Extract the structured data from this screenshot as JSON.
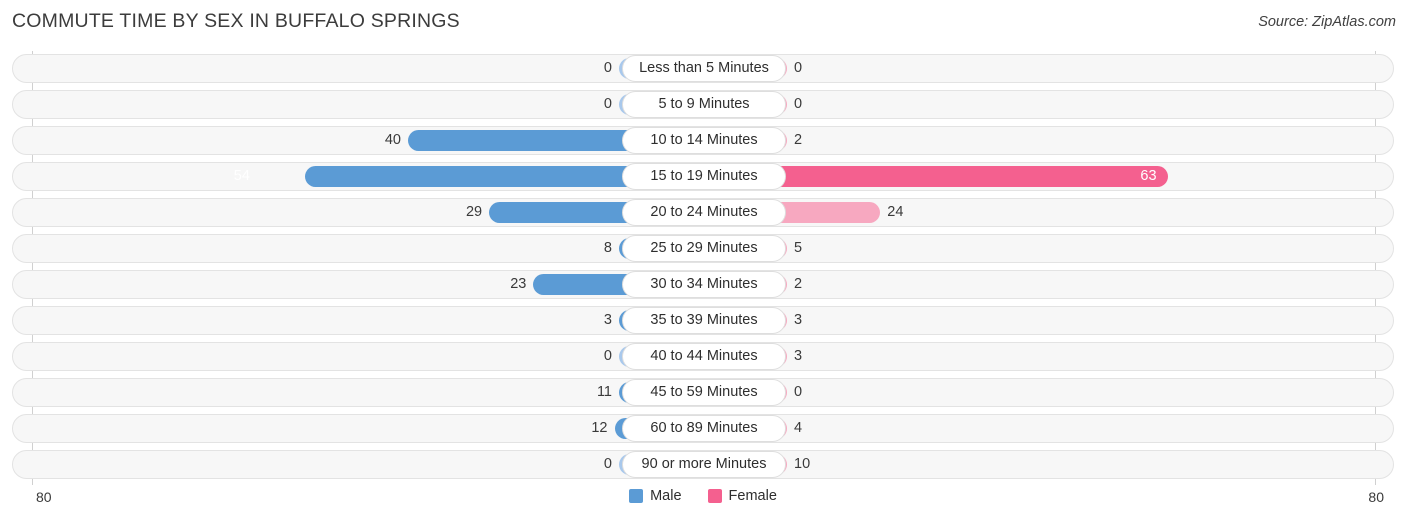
{
  "header": {
    "title": "COMMUTE TIME BY SEX IN BUFFALO SPRINGS",
    "source": "Source: ZipAtlas.com"
  },
  "legend": {
    "items": [
      {
        "label": "Male",
        "color": "#5b9bd5"
      },
      {
        "label": "Female",
        "color": "#f4608f"
      }
    ]
  },
  "axis": {
    "max_left_label": "80",
    "max_right_label": "80"
  },
  "chart_data": {
    "type": "bar",
    "subtype": "diverging-horizontal",
    "title": "COMMUTE TIME BY SEX IN BUFFALO SPRINGS",
    "xlabel": "",
    "ylabel": "",
    "xlim": [
      80,
      80
    ],
    "axis_max": 80,
    "grid": false,
    "legend_position": "bottom-center",
    "categories": [
      "Less than 5 Minutes",
      "5 to 9 Minutes",
      "10 to 14 Minutes",
      "15 to 19 Minutes",
      "20 to 24 Minutes",
      "25 to 29 Minutes",
      "30 to 34 Minutes",
      "35 to 39 Minutes",
      "40 to 44 Minutes",
      "45 to 59 Minutes",
      "60 to 89 Minutes",
      "90 or more Minutes"
    ],
    "series": [
      {
        "name": "Male",
        "direction": "left",
        "color": "#5b9bd5",
        "color_low": "#a8c8ec",
        "values": [
          0,
          0,
          40,
          54,
          29,
          8,
          23,
          3,
          0,
          11,
          12,
          0
        ]
      },
      {
        "name": "Female",
        "direction": "right",
        "color": "#f4608f",
        "color_low": "#f7a8c0",
        "values": [
          0,
          0,
          2,
          63,
          24,
          5,
          2,
          3,
          3,
          0,
          4,
          10
        ]
      }
    ],
    "rows": [
      {
        "category": "Less than 5 Minutes",
        "male": 0,
        "female": 0,
        "male_label": "0",
        "female_label": "0"
      },
      {
        "category": "5 to 9 Minutes",
        "male": 0,
        "female": 0,
        "male_label": "0",
        "female_label": "0"
      },
      {
        "category": "10 to 14 Minutes",
        "male": 40,
        "female": 2,
        "male_label": "40",
        "female_label": "2"
      },
      {
        "category": "15 to 19 Minutes",
        "male": 54,
        "female": 63,
        "male_label": "54",
        "female_label": "63"
      },
      {
        "category": "20 to 24 Minutes",
        "male": 29,
        "female": 24,
        "male_label": "29",
        "female_label": "24"
      },
      {
        "category": "25 to 29 Minutes",
        "male": 8,
        "female": 5,
        "male_label": "8",
        "female_label": "5"
      },
      {
        "category": "30 to 34 Minutes",
        "male": 23,
        "female": 2,
        "male_label": "23",
        "female_label": "2"
      },
      {
        "category": "35 to 39 Minutes",
        "male": 3,
        "female": 3,
        "male_label": "3",
        "female_label": "3"
      },
      {
        "category": "40 to 44 Minutes",
        "male": 0,
        "female": 3,
        "male_label": "0",
        "female_label": "3"
      },
      {
        "category": "45 to 59 Minutes",
        "male": 11,
        "female": 0,
        "male_label": "11",
        "female_label": "0"
      },
      {
        "category": "60 to 89 Minutes",
        "male": 12,
        "female": 4,
        "male_label": "12",
        "female_label": "4"
      },
      {
        "category": "90 or more Minutes",
        "male": 0,
        "female": 10,
        "male_label": "0",
        "female_label": "10"
      }
    ]
  }
}
